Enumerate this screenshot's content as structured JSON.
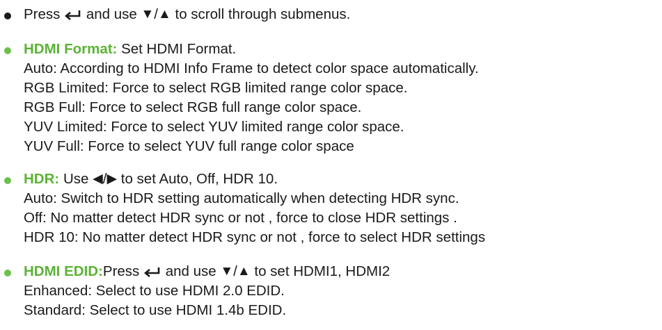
{
  "item1": {
    "press": "Press",
    "text": "and use",
    "slash": "/",
    "text2": "to scroll through submenus."
  },
  "item2": {
    "label": "HDMI Format:",
    "title": " Set HDMI Format.",
    "lines": [
      "Auto: According to HDMI Info Frame to detect color space automatically.",
      "RGB Limited: Force to select RGB limited range color space.",
      "RGB Full: Force to select RGB full range color space.",
      "YUV Limited: Force to select YUV limited range color space.",
      "YUV Full: Force to select YUV full range color space"
    ]
  },
  "item3": {
    "label": "HDR:",
    "use": " Use",
    "slash": "/",
    "title": "to set Auto, Off, HDR 10.",
    "lines": [
      "Auto: Switch to HDR setting automatically when detecting HDR sync.",
      "Off: No matter detect HDR sync or not , force to close HDR settings .",
      "HDR 10: No matter detect HDR sync or not , force to select HDR settings"
    ]
  },
  "item4": {
    "label": "HDMI EDID:",
    "press": "Press",
    "text": "and use",
    "slash": "/",
    "text2": "to set HDMI1, HDMI2",
    "lines": [
      "Enhanced: Select to use HDMI 2.0 EDID.",
      "Standard: Select to use HDMI 1.4b EDID."
    ]
  },
  "colors": {
    "accent": "#5cb335",
    "text": "#1a1a1a"
  },
  "icons": [
    "enter-icon",
    "down-triangle-icon",
    "up-triangle-icon",
    "left-triangle-icon",
    "right-triangle-icon"
  ]
}
